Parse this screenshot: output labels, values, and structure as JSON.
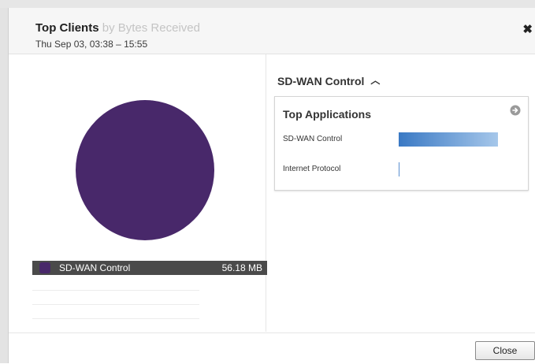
{
  "dialog": {
    "title": "Top Clients",
    "title_sub": "by Bytes Received",
    "date_range": "Thu Sep 03, 03:38 – 15:55",
    "close_x": "✖"
  },
  "left": {
    "pie_color": "#48286a",
    "legend": [
      {
        "label": "SD-WAN Control",
        "value": "56.18 MB",
        "color": "#48286a"
      }
    ]
  },
  "right": {
    "title": "SD-WAN Control",
    "caret": "︿",
    "card_title": "Top Applications",
    "arrow_icon": "circle-arrow-right-icon",
    "apps": [
      {
        "label": "SD-WAN Control",
        "share": 1.0
      },
      {
        "label": "Internet Protocol",
        "share": 0.0
      }
    ]
  },
  "footer": {
    "close_label": "Close"
  }
}
